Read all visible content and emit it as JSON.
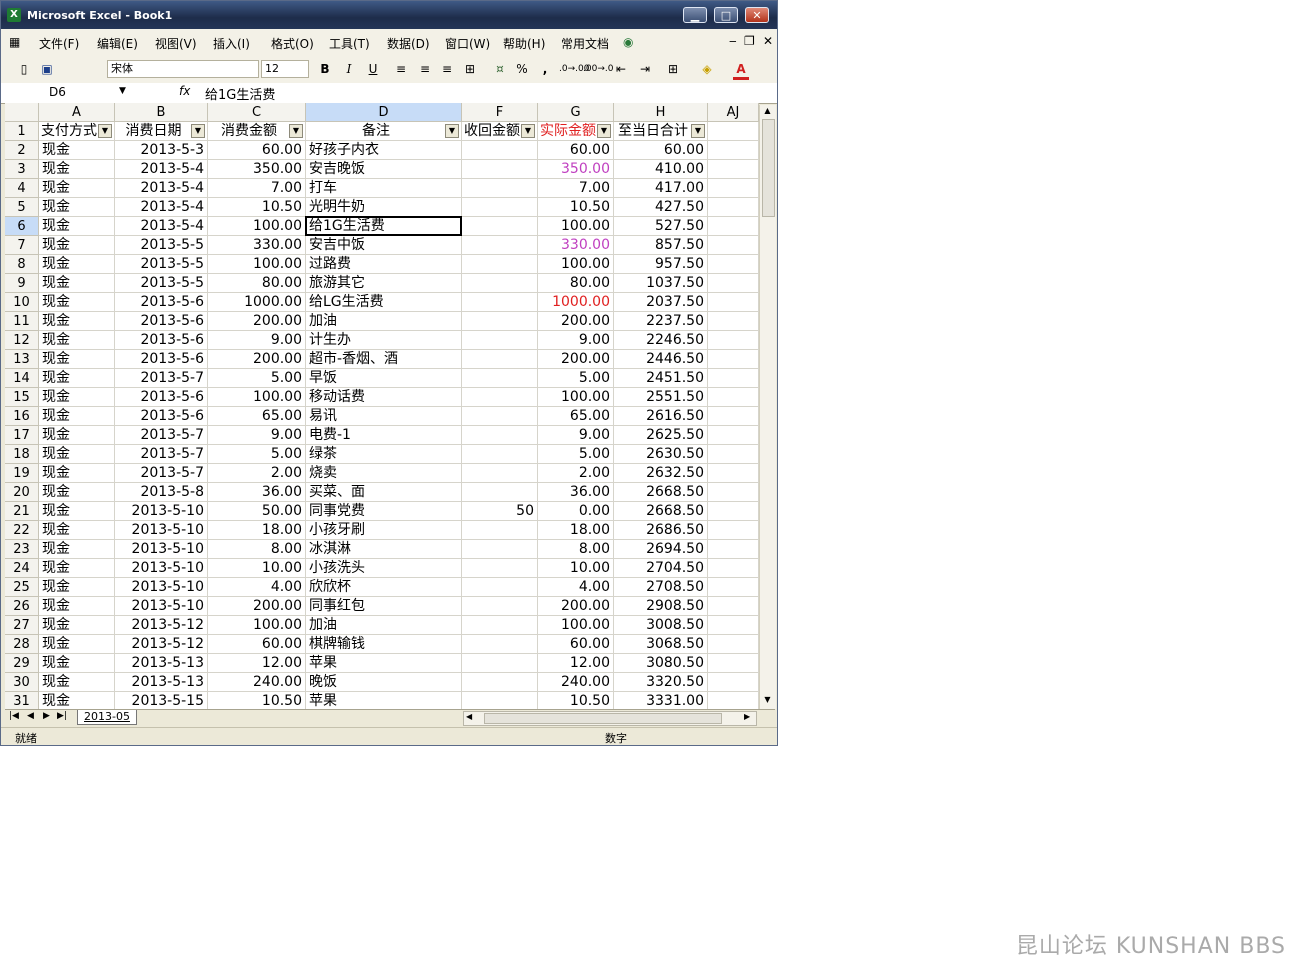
{
  "window": {
    "title": "Microsoft Excel - Book1",
    "app_icon": "excel-icon"
  },
  "menu": [
    "文件(F)",
    "编辑(E)",
    "视图(V)",
    "插入(I)",
    "格式(O)",
    "工具(T)",
    "数据(D)",
    "窗口(W)",
    "帮助(H)",
    "常用文档"
  ],
  "toolbar": {
    "font_name": "宋体",
    "font_size": "12",
    "bold": "B",
    "italic": "I",
    "underline": "U",
    "percent": "%",
    "comma": ",",
    "inc_decimal": ".0→.00",
    "dec_decimal": ".00→.0",
    "font_color": "A"
  },
  "formula_bar": {
    "name_box": "D6",
    "fx": "fx",
    "content": "给1G生活费"
  },
  "columns": [
    "A",
    "B",
    "C",
    "D",
    "F",
    "G",
    "H",
    "AJ"
  ],
  "header_row": {
    "a": "支付方式",
    "b": "消费日期",
    "c": "消费金额",
    "d": "备注",
    "f": "收回金额",
    "g": "实际金额",
    "h": "至当日合计"
  },
  "rows": [
    {
      "n": "2",
      "a": "现金",
      "b": "2013-5-3",
      "c": "60.00",
      "d": "好孩子内衣",
      "f": "",
      "g": "60.00",
      "h": "60.00",
      "gcolor": ""
    },
    {
      "n": "3",
      "a": "现金",
      "b": "2013-5-4",
      "c": "350.00",
      "d": "安吉晚饭",
      "f": "",
      "g": "350.00",
      "h": "410.00",
      "gcolor": "#c040c0"
    },
    {
      "n": "4",
      "a": "现金",
      "b": "2013-5-4",
      "c": "7.00",
      "d": "打车",
      "f": "",
      "g": "7.00",
      "h": "417.00",
      "gcolor": ""
    },
    {
      "n": "5",
      "a": "现金",
      "b": "2013-5-4",
      "c": "10.50",
      "d": "光明牛奶",
      "f": "",
      "g": "10.50",
      "h": "427.50",
      "gcolor": ""
    },
    {
      "n": "6",
      "a": "现金",
      "b": "2013-5-4",
      "c": "100.00",
      "d": "给1G生活费",
      "f": "",
      "g": "100.00",
      "h": "527.50",
      "gcolor": ""
    },
    {
      "n": "7",
      "a": "现金",
      "b": "2013-5-5",
      "c": "330.00",
      "d": "安吉中饭",
      "f": "",
      "g": "330.00",
      "h": "857.50",
      "gcolor": "#c040c0"
    },
    {
      "n": "8",
      "a": "现金",
      "b": "2013-5-5",
      "c": "100.00",
      "d": "过路费",
      "f": "",
      "g": "100.00",
      "h": "957.50",
      "gcolor": ""
    },
    {
      "n": "9",
      "a": "现金",
      "b": "2013-5-5",
      "c": "80.00",
      "d": "旅游其它",
      "f": "",
      "g": "80.00",
      "h": "1037.50",
      "gcolor": ""
    },
    {
      "n": "10",
      "a": "现金",
      "b": "2013-5-6",
      "c": "1000.00",
      "d": "给LG生活费",
      "f": "",
      "g": "1000.00",
      "h": "2037.50",
      "gcolor": "#e02020"
    },
    {
      "n": "11",
      "a": "现金",
      "b": "2013-5-6",
      "c": "200.00",
      "d": "加油",
      "f": "",
      "g": "200.00",
      "h": "2237.50",
      "gcolor": ""
    },
    {
      "n": "12",
      "a": "现金",
      "b": "2013-5-6",
      "c": "9.00",
      "d": "计生办",
      "f": "",
      "g": "9.00",
      "h": "2246.50",
      "gcolor": ""
    },
    {
      "n": "13",
      "a": "现金",
      "b": "2013-5-6",
      "c": "200.00",
      "d": "超市-香烟、酒",
      "f": "",
      "g": "200.00",
      "h": "2446.50",
      "gcolor": ""
    },
    {
      "n": "14",
      "a": "现金",
      "b": "2013-5-7",
      "c": "5.00",
      "d": "早饭",
      "f": "",
      "g": "5.00",
      "h": "2451.50",
      "gcolor": ""
    },
    {
      "n": "15",
      "a": "现金",
      "b": "2013-5-6",
      "c": "100.00",
      "d": "移动话费",
      "f": "",
      "g": "100.00",
      "h": "2551.50",
      "gcolor": ""
    },
    {
      "n": "16",
      "a": "现金",
      "b": "2013-5-6",
      "c": "65.00",
      "d": "易讯",
      "f": "",
      "g": "65.00",
      "h": "2616.50",
      "gcolor": ""
    },
    {
      "n": "17",
      "a": "现金",
      "b": "2013-5-7",
      "c": "9.00",
      "d": "电费-1",
      "f": "",
      "g": "9.00",
      "h": "2625.50",
      "gcolor": ""
    },
    {
      "n": "18",
      "a": "现金",
      "b": "2013-5-7",
      "c": "5.00",
      "d": "绿茶",
      "f": "",
      "g": "5.00",
      "h": "2630.50",
      "gcolor": ""
    },
    {
      "n": "19",
      "a": "现金",
      "b": "2013-5-7",
      "c": "2.00",
      "d": "烧卖",
      "f": "",
      "g": "2.00",
      "h": "2632.50",
      "gcolor": ""
    },
    {
      "n": "20",
      "a": "现金",
      "b": "2013-5-8",
      "c": "36.00",
      "d": "买菜、面",
      "f": "",
      "g": "36.00",
      "h": "2668.50",
      "gcolor": ""
    },
    {
      "n": "21",
      "a": "现金",
      "b": "2013-5-10",
      "c": "50.00",
      "d": "同事党费",
      "f": "50",
      "g": "0.00",
      "h": "2668.50",
      "gcolor": ""
    },
    {
      "n": "22",
      "a": "现金",
      "b": "2013-5-10",
      "c": "18.00",
      "d": "小孩牙刷",
      "f": "",
      "g": "18.00",
      "h": "2686.50",
      "gcolor": ""
    },
    {
      "n": "23",
      "a": "现金",
      "b": "2013-5-10",
      "c": "8.00",
      "d": "冰淇淋",
      "f": "",
      "g": "8.00",
      "h": "2694.50",
      "gcolor": ""
    },
    {
      "n": "24",
      "a": "现金",
      "b": "2013-5-10",
      "c": "10.00",
      "d": "小孩洗头",
      "f": "",
      "g": "10.00",
      "h": "2704.50",
      "gcolor": ""
    },
    {
      "n": "25",
      "a": "现金",
      "b": "2013-5-10",
      "c": "4.00",
      "d": "欣欣杯",
      "f": "",
      "g": "4.00",
      "h": "2708.50",
      "gcolor": ""
    },
    {
      "n": "26",
      "a": "现金",
      "b": "2013-5-10",
      "c": "200.00",
      "d": "同事红包",
      "f": "",
      "g": "200.00",
      "h": "2908.50",
      "gcolor": ""
    },
    {
      "n": "27",
      "a": "现金",
      "b": "2013-5-12",
      "c": "100.00",
      "d": "加油",
      "f": "",
      "g": "100.00",
      "h": "3008.50",
      "gcolor": ""
    },
    {
      "n": "28",
      "a": "现金",
      "b": "2013-5-12",
      "c": "60.00",
      "d": "棋牌输钱",
      "f": "",
      "g": "60.00",
      "h": "3068.50",
      "gcolor": ""
    },
    {
      "n": "29",
      "a": "现金",
      "b": "2013-5-13",
      "c": "12.00",
      "d": "苹果",
      "f": "",
      "g": "12.00",
      "h": "3080.50",
      "gcolor": ""
    },
    {
      "n": "30",
      "a": "现金",
      "b": "2013-5-13",
      "c": "240.00",
      "d": "晚饭",
      "f": "",
      "g": "240.00",
      "h": "3320.50",
      "gcolor": ""
    },
    {
      "n": "31",
      "a": "现金",
      "b": "2013-5-15",
      "c": "10.50",
      "d": "苹果",
      "f": "",
      "g": "10.50",
      "h": "3331.00",
      "gcolor": ""
    }
  ],
  "selected_row": "6",
  "sheet_tab": "2013-05",
  "status": {
    "left": "就绪",
    "right": "数字"
  },
  "watermark": "昆山论坛 KUNSHAN BBS",
  "colors": {
    "g_header": "#e02020",
    "selection": "#c7dcf7"
  }
}
